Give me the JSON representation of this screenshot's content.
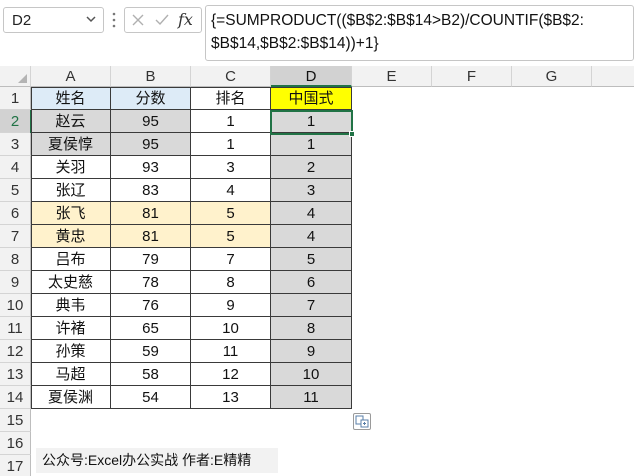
{
  "formula_bar": {
    "name_box": "D2",
    "fx_label": "fx",
    "formula_line1": "{=SUMPRODUCT(($B$2:$B$14>B2)/COUNTIF($B$2:",
    "formula_line2": "$B$14,$B$2:$B$14))+1}"
  },
  "columns": [
    "A",
    "B",
    "C",
    "D",
    "E",
    "F",
    "G"
  ],
  "rows": [
    "1",
    "2",
    "3",
    "4",
    "5",
    "6",
    "7",
    "8",
    "9",
    "10",
    "11",
    "12",
    "13",
    "14",
    "15",
    "16",
    "17"
  ],
  "table": {
    "headers": [
      "姓名",
      "分数",
      "排名",
      "中国式"
    ],
    "rows": [
      [
        "赵云",
        "95",
        "1",
        "1"
      ],
      [
        "夏侯惇",
        "95",
        "1",
        "1"
      ],
      [
        "关羽",
        "93",
        "3",
        "2"
      ],
      [
        "张辽",
        "83",
        "4",
        "3"
      ],
      [
        "张飞",
        "81",
        "5",
        "4"
      ],
      [
        "黄忠",
        "81",
        "5",
        "4"
      ],
      [
        "吕布",
        "79",
        "7",
        "5"
      ],
      [
        "太史慈",
        "78",
        "8",
        "6"
      ],
      [
        "典韦",
        "76",
        "9",
        "7"
      ],
      [
        "许褚",
        "65",
        "10",
        "8"
      ],
      [
        "孙策",
        "59",
        "11",
        "9"
      ],
      [
        "马超",
        "58",
        "12",
        "10"
      ],
      [
        "夏侯渊",
        "54",
        "13",
        "11"
      ]
    ]
  },
  "footer_note": "公众号:Excel办公实战  作者:E精精",
  "icons": [
    "chevron-down-icon",
    "more-vertical-icon",
    "cancel-x-icon",
    "check-icon",
    "paste-options-icon"
  ],
  "colors": {
    "header_blue": "#ddebf7",
    "header_yellow": "#ffff00",
    "highlight_gray": "#d9d9d9",
    "highlight_cream": "#fff2cc",
    "excel_green": "#217346"
  }
}
